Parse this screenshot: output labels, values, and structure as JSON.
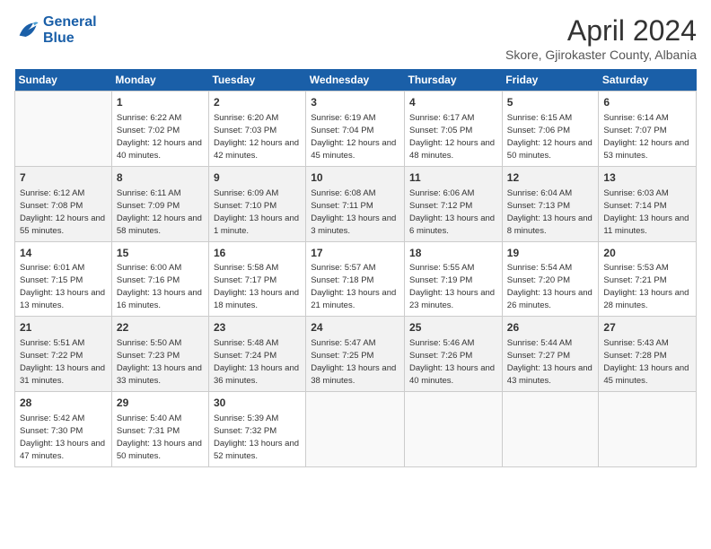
{
  "header": {
    "logo_line1": "General",
    "logo_line2": "Blue",
    "month": "April 2024",
    "location": "Skore, Gjirokaster County, Albania"
  },
  "days_of_week": [
    "Sunday",
    "Monday",
    "Tuesday",
    "Wednesday",
    "Thursday",
    "Friday",
    "Saturday"
  ],
  "weeks": [
    [
      {
        "num": "",
        "sunrise": "",
        "sunset": "",
        "daylight": ""
      },
      {
        "num": "1",
        "sunrise": "Sunrise: 6:22 AM",
        "sunset": "Sunset: 7:02 PM",
        "daylight": "Daylight: 12 hours and 40 minutes."
      },
      {
        "num": "2",
        "sunrise": "Sunrise: 6:20 AM",
        "sunset": "Sunset: 7:03 PM",
        "daylight": "Daylight: 12 hours and 42 minutes."
      },
      {
        "num": "3",
        "sunrise": "Sunrise: 6:19 AM",
        "sunset": "Sunset: 7:04 PM",
        "daylight": "Daylight: 12 hours and 45 minutes."
      },
      {
        "num": "4",
        "sunrise": "Sunrise: 6:17 AM",
        "sunset": "Sunset: 7:05 PM",
        "daylight": "Daylight: 12 hours and 48 minutes."
      },
      {
        "num": "5",
        "sunrise": "Sunrise: 6:15 AM",
        "sunset": "Sunset: 7:06 PM",
        "daylight": "Daylight: 12 hours and 50 minutes."
      },
      {
        "num": "6",
        "sunrise": "Sunrise: 6:14 AM",
        "sunset": "Sunset: 7:07 PM",
        "daylight": "Daylight: 12 hours and 53 minutes."
      }
    ],
    [
      {
        "num": "7",
        "sunrise": "Sunrise: 6:12 AM",
        "sunset": "Sunset: 7:08 PM",
        "daylight": "Daylight: 12 hours and 55 minutes."
      },
      {
        "num": "8",
        "sunrise": "Sunrise: 6:11 AM",
        "sunset": "Sunset: 7:09 PM",
        "daylight": "Daylight: 12 hours and 58 minutes."
      },
      {
        "num": "9",
        "sunrise": "Sunrise: 6:09 AM",
        "sunset": "Sunset: 7:10 PM",
        "daylight": "Daylight: 13 hours and 1 minute."
      },
      {
        "num": "10",
        "sunrise": "Sunrise: 6:08 AM",
        "sunset": "Sunset: 7:11 PM",
        "daylight": "Daylight: 13 hours and 3 minutes."
      },
      {
        "num": "11",
        "sunrise": "Sunrise: 6:06 AM",
        "sunset": "Sunset: 7:12 PM",
        "daylight": "Daylight: 13 hours and 6 minutes."
      },
      {
        "num": "12",
        "sunrise": "Sunrise: 6:04 AM",
        "sunset": "Sunset: 7:13 PM",
        "daylight": "Daylight: 13 hours and 8 minutes."
      },
      {
        "num": "13",
        "sunrise": "Sunrise: 6:03 AM",
        "sunset": "Sunset: 7:14 PM",
        "daylight": "Daylight: 13 hours and 11 minutes."
      }
    ],
    [
      {
        "num": "14",
        "sunrise": "Sunrise: 6:01 AM",
        "sunset": "Sunset: 7:15 PM",
        "daylight": "Daylight: 13 hours and 13 minutes."
      },
      {
        "num": "15",
        "sunrise": "Sunrise: 6:00 AM",
        "sunset": "Sunset: 7:16 PM",
        "daylight": "Daylight: 13 hours and 16 minutes."
      },
      {
        "num": "16",
        "sunrise": "Sunrise: 5:58 AM",
        "sunset": "Sunset: 7:17 PM",
        "daylight": "Daylight: 13 hours and 18 minutes."
      },
      {
        "num": "17",
        "sunrise": "Sunrise: 5:57 AM",
        "sunset": "Sunset: 7:18 PM",
        "daylight": "Daylight: 13 hours and 21 minutes."
      },
      {
        "num": "18",
        "sunrise": "Sunrise: 5:55 AM",
        "sunset": "Sunset: 7:19 PM",
        "daylight": "Daylight: 13 hours and 23 minutes."
      },
      {
        "num": "19",
        "sunrise": "Sunrise: 5:54 AM",
        "sunset": "Sunset: 7:20 PM",
        "daylight": "Daylight: 13 hours and 26 minutes."
      },
      {
        "num": "20",
        "sunrise": "Sunrise: 5:53 AM",
        "sunset": "Sunset: 7:21 PM",
        "daylight": "Daylight: 13 hours and 28 minutes."
      }
    ],
    [
      {
        "num": "21",
        "sunrise": "Sunrise: 5:51 AM",
        "sunset": "Sunset: 7:22 PM",
        "daylight": "Daylight: 13 hours and 31 minutes."
      },
      {
        "num": "22",
        "sunrise": "Sunrise: 5:50 AM",
        "sunset": "Sunset: 7:23 PM",
        "daylight": "Daylight: 13 hours and 33 minutes."
      },
      {
        "num": "23",
        "sunrise": "Sunrise: 5:48 AM",
        "sunset": "Sunset: 7:24 PM",
        "daylight": "Daylight: 13 hours and 36 minutes."
      },
      {
        "num": "24",
        "sunrise": "Sunrise: 5:47 AM",
        "sunset": "Sunset: 7:25 PM",
        "daylight": "Daylight: 13 hours and 38 minutes."
      },
      {
        "num": "25",
        "sunrise": "Sunrise: 5:46 AM",
        "sunset": "Sunset: 7:26 PM",
        "daylight": "Daylight: 13 hours and 40 minutes."
      },
      {
        "num": "26",
        "sunrise": "Sunrise: 5:44 AM",
        "sunset": "Sunset: 7:27 PM",
        "daylight": "Daylight: 13 hours and 43 minutes."
      },
      {
        "num": "27",
        "sunrise": "Sunrise: 5:43 AM",
        "sunset": "Sunset: 7:28 PM",
        "daylight": "Daylight: 13 hours and 45 minutes."
      }
    ],
    [
      {
        "num": "28",
        "sunrise": "Sunrise: 5:42 AM",
        "sunset": "Sunset: 7:30 PM",
        "daylight": "Daylight: 13 hours and 47 minutes."
      },
      {
        "num": "29",
        "sunrise": "Sunrise: 5:40 AM",
        "sunset": "Sunset: 7:31 PM",
        "daylight": "Daylight: 13 hours and 50 minutes."
      },
      {
        "num": "30",
        "sunrise": "Sunrise: 5:39 AM",
        "sunset": "Sunset: 7:32 PM",
        "daylight": "Daylight: 13 hours and 52 minutes."
      },
      {
        "num": "",
        "sunrise": "",
        "sunset": "",
        "daylight": ""
      },
      {
        "num": "",
        "sunrise": "",
        "sunset": "",
        "daylight": ""
      },
      {
        "num": "",
        "sunrise": "",
        "sunset": "",
        "daylight": ""
      },
      {
        "num": "",
        "sunrise": "",
        "sunset": "",
        "daylight": ""
      }
    ]
  ]
}
